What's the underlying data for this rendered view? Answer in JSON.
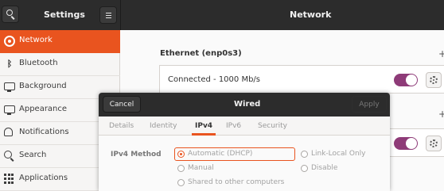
{
  "titlebar": {
    "settings_title": "Settings",
    "network_title": "Network"
  },
  "sidebar": {
    "items": [
      {
        "label": "Network",
        "icon": "wifi-icon",
        "active": true
      },
      {
        "label": "Bluetooth",
        "icon": "bluetooth-icon",
        "active": false
      },
      {
        "label": "Background",
        "icon": "monitor-icon",
        "active": false
      },
      {
        "label": "Appearance",
        "icon": "monitor-icon",
        "active": false
      },
      {
        "label": "Notifications",
        "icon": "bell-icon",
        "active": false
      },
      {
        "label": "Search",
        "icon": "search-icon",
        "active": false
      },
      {
        "label": "Applications",
        "icon": "grid-icon",
        "active": false
      }
    ]
  },
  "main": {
    "ethernet_title": "Ethernet (enp0s3)",
    "connection_status": "Connected - 1000 Mb/s",
    "add_symbol": "+",
    "toggle_on": true
  },
  "dialog": {
    "title": "Wired",
    "cancel_label": "Cancel",
    "apply_label": "Apply",
    "tabs": [
      "Details",
      "Identity",
      "IPv4",
      "IPv6",
      "Security"
    ],
    "active_tab": "IPv4",
    "method_label": "IPv4 Method",
    "options": [
      {
        "label": "Automatic (DHCP)",
        "checked": true
      },
      {
        "label": "Link-Local Only",
        "checked": false
      },
      {
        "label": "Manual",
        "checked": false
      },
      {
        "label": "Disable",
        "checked": false
      },
      {
        "label": "Shared to other computers",
        "checked": false
      }
    ]
  },
  "colors": {
    "accent": "#e9541f",
    "headerbar": "#2c2c2c",
    "toggle": "#8e3b78"
  }
}
